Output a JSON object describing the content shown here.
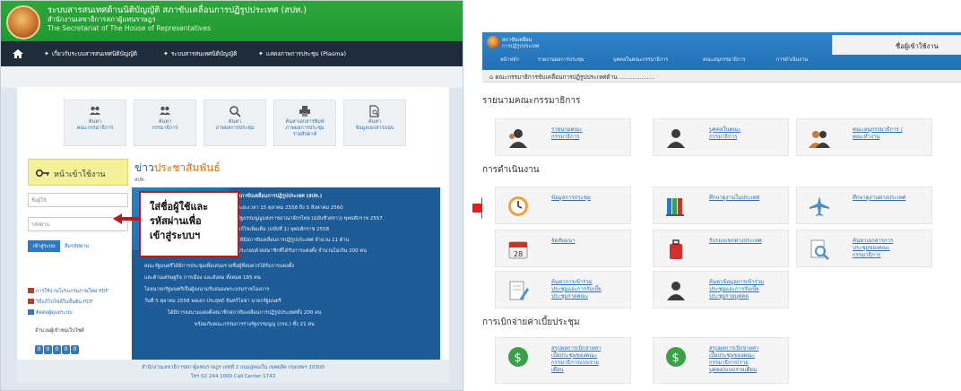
{
  "left_screen": {
    "header": {
      "title_line1": "ระบบสารสนเทศด้านนิติบัญญัติ สภาขับเคลื่อนการปฏิรูปประเทศ (สปท.)",
      "title_line2": "สำนักงานเลขาธิการสภาผู้แทนราษฎร",
      "title_line3": "The Secretariat of The House of Representatives"
    },
    "nav": {
      "items": [
        "เกี่ยวกับระบบสารสนเทศนิติบัญญัติ",
        "ระบบสารสนเทศนิติบัญญัติ",
        "แสดงภาพการประชุม (Plasma)"
      ]
    },
    "tiles": [
      {
        "line1": "ค้นหา",
        "line2": "คณะกรรมาธิการ",
        "line3": ""
      },
      {
        "line1": "ค้นหา",
        "line2": "กรรมาธิการ",
        "line3": ""
      },
      {
        "line1": "ค้นหา",
        "line2": "ภาพผลการประชุม",
        "line3": ""
      },
      {
        "line1": "ค้นหาเอกสารพิมพ์",
        "line2": "ภาพผลการประชุม",
        "line3": "รายสัปดาห์"
      },
      {
        "line1": "ค้นหา",
        "line2": "ข้อมูลเอกสารแนบ",
        "line3": ""
      }
    ],
    "login": {
      "title": "หน้าเข้าใช้งาน",
      "username_placeholder": "ชื่อผู้ใช้",
      "password_placeholder": "รหัสผ่าน",
      "submit_label": "เข้าสู่ระบบ",
      "forgot_label": "ลืมรหัสผ่าน"
    },
    "side_links": [
      "การใช้งานโปรแกรมภาพใหม่ PDF",
      "วิธีแก้ไขไฟล์ในขั้นต้น PDF",
      "ติดต่อผู้ดูแลระบบ"
    ],
    "visitor_label": "จำนวนผู้เข้าชมเว็บไซต์",
    "counter_digits": [
      "0",
      "0",
      "0",
      "0",
      "0"
    ],
    "news": {
      "title_prefix": "ข่าว",
      "title_highlight": "ประชาสัมพันธ์",
      "subtitle": "สปท.",
      "lines": [
        "สภาขับเคลื่อนการปฏิรูปประเทศ (สปท.)",
        "ระยะเวลา 15 ตุลาคม 2558 ถึง 5 สิงหาคม 2560",
        "รัฐธรรมนูญแห่งราชอาณาจักรไทย (ฉบับชั่วคราว) พุทธศักราช 2557",
        "แก้ไขเพิ่มเติม (ฉบับที่ 1) พุทธศักราช 2558",
        "ให้มีสภาขับเคลื่อนการปฏิรูปประเทศ จำนวน 11 ด้าน",
        "ประกอบด้วยสมาชิกที่ได้รับการแต่งตั้ง จำนวนไม่เกิน 200 คน",
        "คณะรัฐมนตรีได้มีการประชุมเพื่อเสนอรายชื่อผู้ที่สมควรได้รับการแต่งตั้ง",
        "และด้านเศรษฐกิจ การเมือง และสังคม ทั้งหมด 185 คน",
        "โดยนายกรัฐมนตรีเป็นผู้ลงนามรับสนองพระบรมราชโองการ",
        "วันที่ 5 ตุลาคม 2558 พลเอก ประยุทธ์ จันทร์โอชา นายกรัฐมนตรี",
        "ได้มีการลงนามแต่งตั้งสมาชิกสภาขับเคลื่อนการปฏิรูปประเทศทั้ง 200 คน",
        "พร้อมกับคณะกรรมการร่างรัฐธรรมนูญ (กรธ.) ทั้ง 21 คน"
      ]
    },
    "callout": {
      "line1": "ใส่ชื่อผู้ใช้และ",
      "line2": "รหัสผ่านเพื่อ",
      "line3": "เข้าสู่ระบบฯ"
    },
    "footer": {
      "line1": "สำนักงานเลขาธิการสภาผู้แทนราษฎร เลขที่ 2 ถนนอู่ทองใน เขตดุสิต กรุงเทพฯ 10300",
      "line2": "โทร 02 244 1000 Call Center 1743"
    }
  },
  "right_screen": {
    "header": {
      "brand_line1": "สภาขับเคลื่อน",
      "brand_line2": "การปฏิรูปประเทศ",
      "user_label": "ชื่อผู้เข้าใช้งาน",
      "menu": [
        "หน้าหลัก",
        "รายงานผลการประชุม",
        "บุคคลในคณะกรรมาธิการ",
        "คณะอนุกรรมาธิการ",
        "การดำเนินงาน"
      ]
    },
    "breadcrumb": "คณะกรรมาธิการขับเคลื่อนการปฏิรูปประเทศด้าน ...................",
    "sections": [
      {
        "title": "รายนามคณะกรรมาธิการ",
        "tiles": [
          {
            "label": "รายนามคณะ\nกรรมาธิการ",
            "icon": "people-icon"
          },
          {
            "label": "บุคคลในคณะ\nกรรมาธิการ",
            "icon": "person-icon"
          },
          {
            "label": "คณะอนุกรรมาธิการ /\nคณะทำงาน",
            "icon": "group-icon"
          }
        ]
      },
      {
        "title": "การดำเนินงาน",
        "tiles": [
          {
            "label": "ข้อมูลการประชุม",
            "icon": "clock-icon"
          },
          {
            "label": "ศึกษาดูงานในประเทศ",
            "icon": "books-icon"
          },
          {
            "label": "ศึกษาดูงานต่างประเทศ",
            "icon": "airplane-icon"
          },
          {
            "label": "จัดสัมมนา",
            "icon": "calendar-icon"
          },
          {
            "label": "รับรองแขกต่างประเทศ",
            "icon": "luggage-icon"
          },
          {
            "label": "ค้นหาเอกสารการ\nประชุมของคณะ\nกรรมาธิการ",
            "icon": "search-doc-icon"
          },
          {
            "label": "ค้นหาการเข้าร่วม\nประชุมและการรับเบี้ย\nประชุมรายคณะ",
            "icon": "doc-edit-icon"
          },
          {
            "label": "ค้นหาข้อมูลการเข้าร่วม\nประชุมและการรับเบี้ย\nประชุมรายบุคคล",
            "icon": "person-icon"
          }
        ]
      },
      {
        "title": "การเบิกจ่ายค่าเบี้ยประชุม",
        "tiles": [
          {
            "label": "สรุปผลการเบิกจ่ายค่า\nเบี้ยประชุมของคณะ\nกรรมาธิการแบบราย\nเดือน",
            "icon": "money-icon"
          },
          {
            "label": "สรุปผลการเบิกจ่ายค่า\nเบี้ยประชุมของคณะ\nกรรมาธิการ(ราย\nบุคคล)แบบรายเดือน",
            "icon": "money-icon"
          }
        ]
      }
    ]
  },
  "colors": {
    "header_green": "#2ea63c",
    "nav_dark": "#1f2d3a",
    "news_blue": "#1d5c97",
    "login_yellow": "#f6f09a",
    "callout_red": "#c01818",
    "arrow_red": "#e41e1e",
    "right_header_blue": "#2f84c9",
    "link_blue": "#2a6fb0"
  }
}
